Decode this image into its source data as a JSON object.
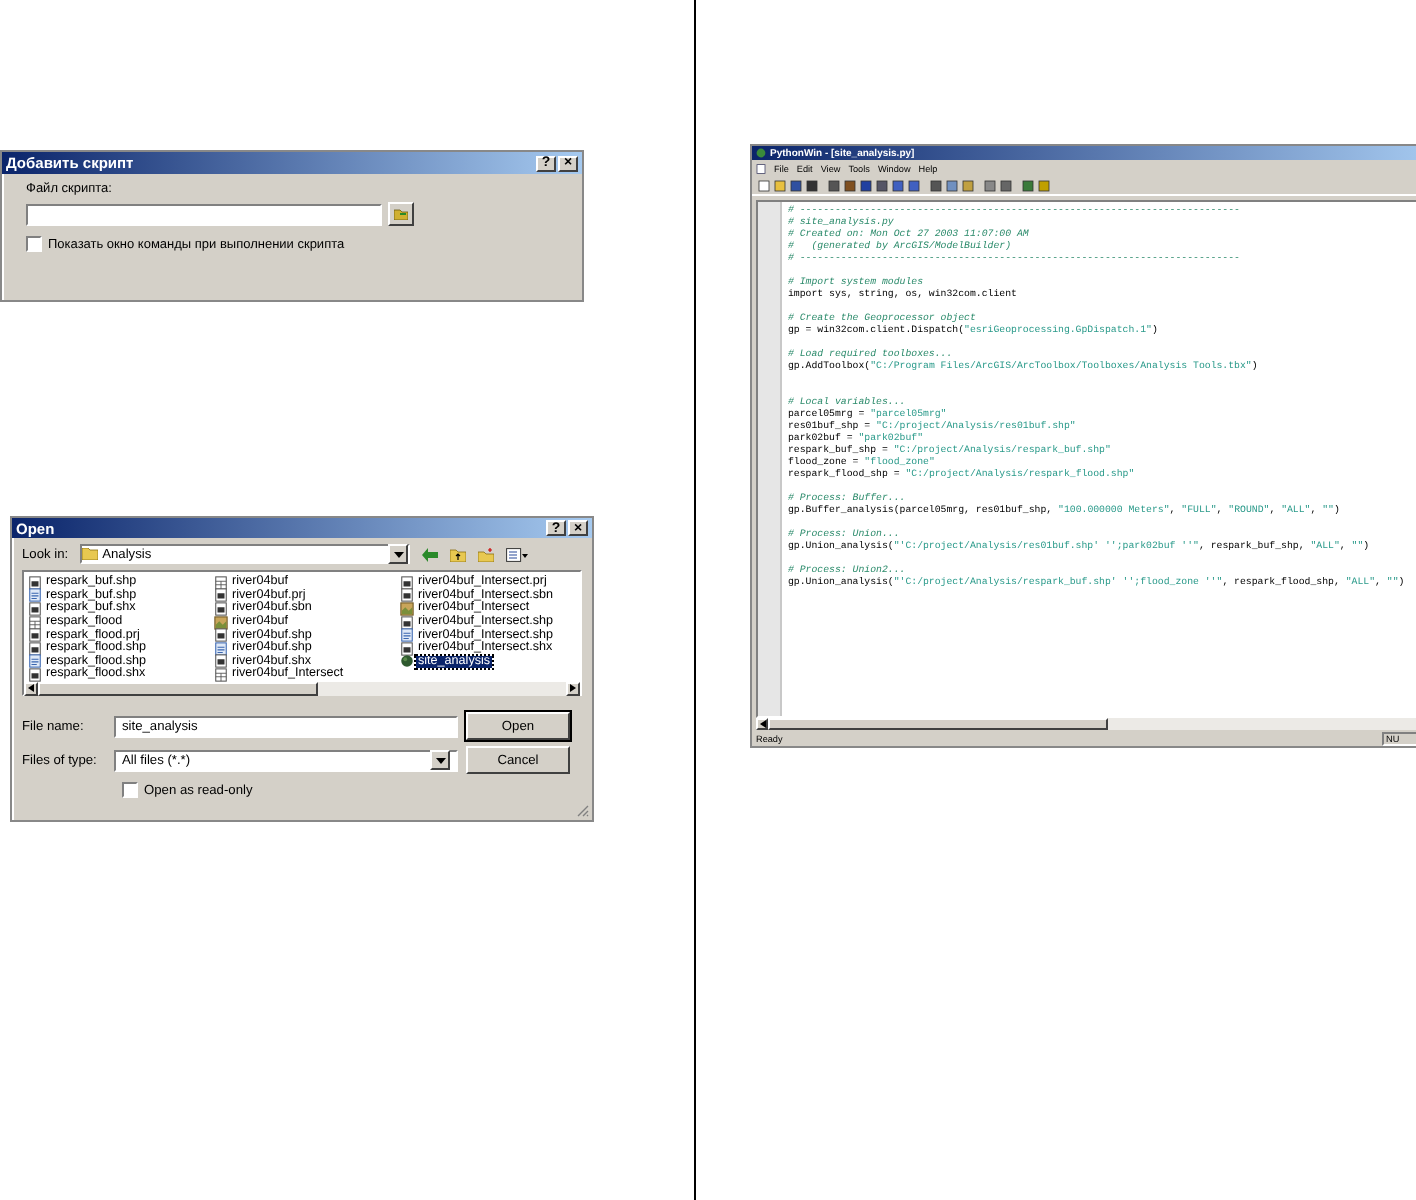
{
  "add_script_dialog": {
    "title": "Добавить скрипт",
    "help": "?",
    "close": "×",
    "file_label": "Файл скрипта:",
    "show_console": {
      "label": "Показать окно команды при выполнении скрипта",
      "checked": false
    }
  },
  "open_dialog": {
    "title": "Open",
    "help": "?",
    "close": "×",
    "look_in_label": "Look in:",
    "look_in_value": "Analysis",
    "files": [
      {
        "name": "respark_buf.shp",
        "kind": "file",
        "selected": false
      },
      {
        "name": "respark_buf.shp",
        "kind": "xml",
        "selected": false
      },
      {
        "name": "respark_buf.shx",
        "kind": "file",
        "selected": false
      },
      {
        "name": "respark_flood",
        "kind": "table",
        "selected": false
      },
      {
        "name": "respark_flood.prj",
        "kind": "file",
        "selected": false
      },
      {
        "name": "respark_flood.shp",
        "kind": "file",
        "selected": false
      },
      {
        "name": "respark_flood.shp",
        "kind": "xml",
        "selected": false
      },
      {
        "name": "respark_flood.shx",
        "kind": "file",
        "selected": false
      },
      {
        "name": "river04buf",
        "kind": "table",
        "selected": false
      },
      {
        "name": "river04buf.prj",
        "kind": "file",
        "selected": false
      },
      {
        "name": "river04buf.sbn",
        "kind": "file",
        "selected": false
      },
      {
        "name": "river04buf",
        "kind": "layer",
        "selected": false
      },
      {
        "name": "river04buf.shp",
        "kind": "file",
        "selected": false
      },
      {
        "name": "river04buf.shp",
        "kind": "xml",
        "selected": false
      },
      {
        "name": "river04buf.shx",
        "kind": "file",
        "selected": false
      },
      {
        "name": "river04buf_Intersect",
        "kind": "table",
        "selected": false
      },
      {
        "name": "river04buf_Intersect.prj",
        "kind": "file",
        "selected": false
      },
      {
        "name": "river04buf_Intersect.sbn",
        "kind": "file",
        "selected": false
      },
      {
        "name": "river04buf_Intersect",
        "kind": "layer",
        "selected": false
      },
      {
        "name": "river04buf_Intersect.shp",
        "kind": "file",
        "selected": false
      },
      {
        "name": "river04buf_Intersect.shp",
        "kind": "xml",
        "selected": false
      },
      {
        "name": "river04buf_Intersect.shx",
        "kind": "file",
        "selected": false
      },
      {
        "name": "site_analysis",
        "kind": "script",
        "selected": true
      }
    ],
    "file_name_label": "File name:",
    "file_name_value": "site_analysis",
    "open_button": "Open",
    "file_type_label": "Files of type:",
    "file_type_value": "All files (*.*)",
    "cancel_button": "Cancel",
    "read_only": {
      "label": "Open as read-only",
      "checked": false
    }
  },
  "pythonwin": {
    "title": "PythonWin - [site_analysis.py]",
    "menu": [
      "File",
      "Edit",
      "View",
      "Tools",
      "Window",
      "Help"
    ],
    "code": [
      {
        "kind": "comment",
        "text": "# ---------------------------------------------------------------------------"
      },
      {
        "kind": "comment",
        "text": "# site_analysis.py"
      },
      {
        "kind": "comment",
        "text": "# Created on: Mon Oct 27 2003 11:07:00 AM"
      },
      {
        "kind": "comment",
        "text": "#   (generated by ArcGIS/ModelBuilder)"
      },
      {
        "kind": "comment",
        "text": "# ---------------------------------------------------------------------------"
      },
      {
        "kind": "blank"
      },
      {
        "kind": "comment",
        "text": "# Import system modules"
      },
      {
        "kind": "code",
        "text": "import sys, string, os, win32com.client"
      },
      {
        "kind": "blank"
      },
      {
        "kind": "comment",
        "text": "# Create the Geoprocessor object"
      },
      {
        "kind": "code",
        "text": "gp = win32com.client.Dispatch(\"esriGeoprocessing.GpDispatch.1\")"
      },
      {
        "kind": "blank"
      },
      {
        "kind": "comment",
        "text": "# Load required toolboxes..."
      },
      {
        "kind": "code",
        "text": "gp.AddToolbox(\"C:/Program Files/ArcGIS/ArcToolbox/Toolboxes/Analysis Tools.tbx\")"
      },
      {
        "kind": "blank"
      },
      {
        "kind": "blank"
      },
      {
        "kind": "comment",
        "text": "# Local variables..."
      },
      {
        "kind": "code",
        "text": "parcel05mrg = \"parcel05mrg\""
      },
      {
        "kind": "code",
        "text": "res01buf_shp = \"C:/project/Analysis/res01buf.shp\""
      },
      {
        "kind": "code",
        "text": "park02buf = \"park02buf\""
      },
      {
        "kind": "code",
        "text": "respark_buf_shp = \"C:/project/Analysis/respark_buf.shp\""
      },
      {
        "kind": "code",
        "text": "flood_zone = \"flood_zone\""
      },
      {
        "kind": "code",
        "text": "respark_flood_shp = \"C:/project/Analysis/respark_flood.shp\""
      },
      {
        "kind": "blank"
      },
      {
        "kind": "comment",
        "text": "# Process: Buffer..."
      },
      {
        "kind": "code",
        "text": "gp.Buffer_analysis(parcel05mrg, res01buf_shp, \"100.000000 Meters\", \"FULL\", \"ROUND\", \"ALL\", \"\")"
      },
      {
        "kind": "blank"
      },
      {
        "kind": "comment",
        "text": "# Process: Union..."
      },
      {
        "kind": "code",
        "text": "gp.Union_analysis(\"'C:/project/Analysis/res01buf.shp' '';park02buf ''\", respark_buf_shp, \"ALL\", \"\")"
      },
      {
        "kind": "blank"
      },
      {
        "kind": "comment",
        "text": "# Process: Union2..."
      },
      {
        "kind": "code",
        "text": "gp.Union_analysis(\"'C:/project/Analysis/respark_buf.shp' '';flood_zone ''\", respark_flood_shp, \"ALL\", \"\")"
      }
    ],
    "status": "Ready",
    "status_right": "NU"
  }
}
